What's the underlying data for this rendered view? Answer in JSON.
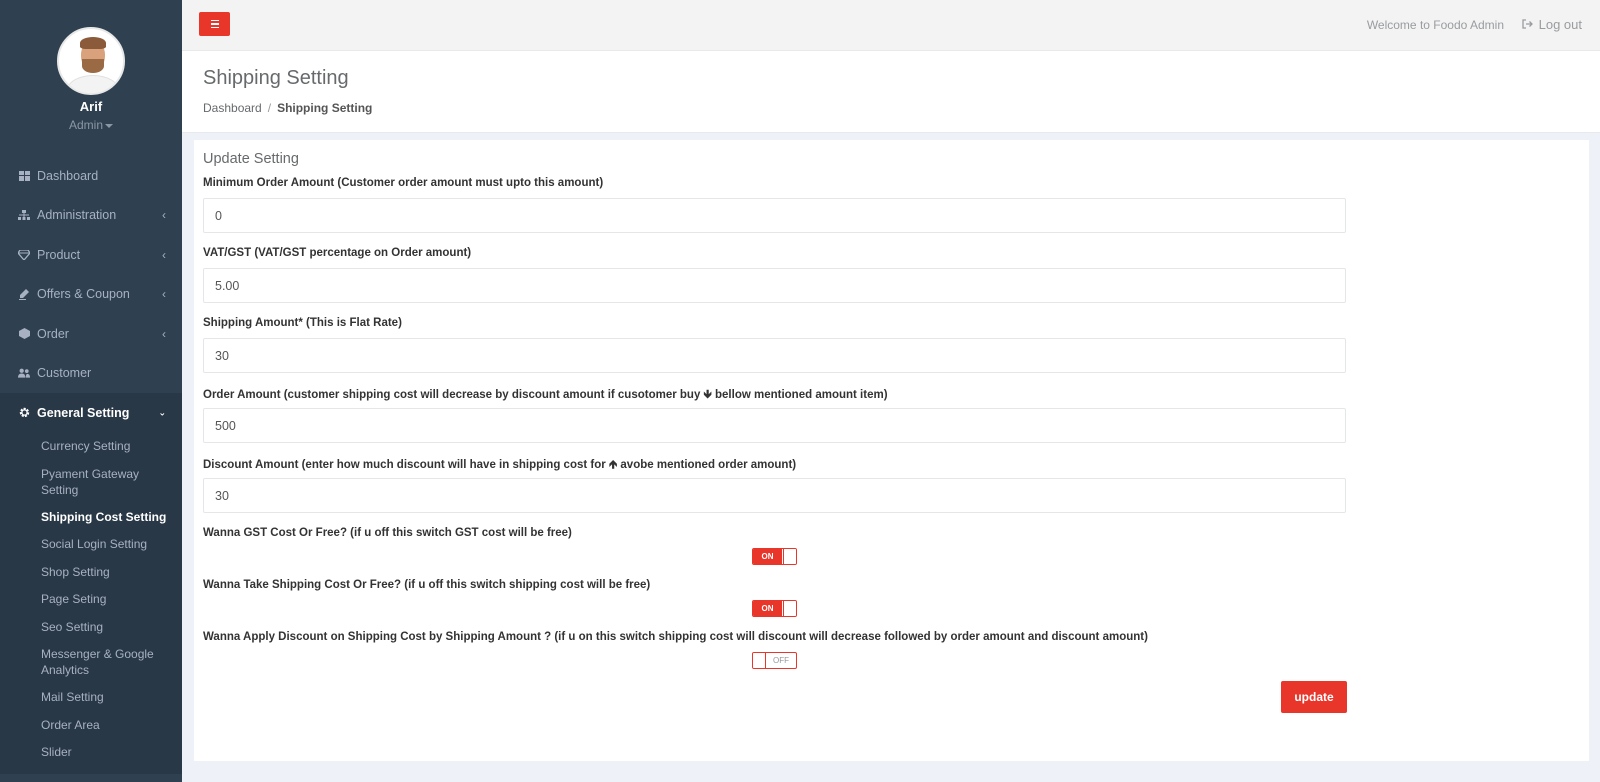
{
  "sidebar": {
    "profile": {
      "name": "Arif",
      "role": "Admin"
    },
    "items": [
      {
        "label": "Dashboard",
        "icon": "dashboard-icon"
      },
      {
        "label": "Administration",
        "icon": "sitemap-icon"
      },
      {
        "label": "Product",
        "icon": "diamond-icon"
      },
      {
        "label": "Offers & Coupon",
        "icon": "edit-icon"
      },
      {
        "label": "Order",
        "icon": "cube-icon"
      },
      {
        "label": "Customer",
        "icon": "users-icon"
      },
      {
        "label": "General Setting",
        "icon": "gear-icon"
      }
    ],
    "submenu": [
      "Currency Setting",
      "Pyament Gateway Setting",
      "Shipping Cost Setting",
      "Social Login Setting",
      "Shop Setting",
      "Page Seting",
      "Seo Setting",
      "Messenger & Google Analytics",
      "Mail Setting",
      "Order Area",
      "Slider"
    ]
  },
  "topbar": {
    "welcome": "Welcome to Foodo Admin",
    "logout": "Log out"
  },
  "heading": {
    "title": "Shipping Setting",
    "breadcrumb": {
      "home": "Dashboard",
      "separator": "/",
      "current": "Shipping Setting"
    }
  },
  "form": {
    "title": "Update Setting",
    "fields": [
      {
        "label": "Minimum Order Amount (Customer order amount must upto this amount)",
        "value": "0"
      },
      {
        "label": "VAT/GST (VAT/GST percentage on Order amount)",
        "value": "5.00"
      },
      {
        "label": "Shipping Amount* (This is Flat Rate)",
        "value": "30"
      },
      {
        "label_before": "Order Amount (customer shipping cost will decrease by discount amount if cusotomer buy",
        "arrow": "🡻",
        "label_after": "bellow mentioned amount item)",
        "value": "500"
      },
      {
        "label_before": "Discount Amount (enter how much discount will have in shipping cost for",
        "arrow": "🡹",
        "label_after": "avobe mentioned order amount)",
        "value": "30"
      }
    ],
    "switches": [
      {
        "label": "Wanna GST Cost Or Free? (if u off this switch GST cost will be free)",
        "state": "ON"
      },
      {
        "label": "Wanna Take Shipping Cost Or Free? (if u off this switch shipping cost will be free)",
        "state": "ON"
      },
      {
        "label": "Wanna Apply Discount on Shipping Cost by Shipping Amount ? (if u on this switch shipping cost will discount will decrease followed by order amount and discount amount)",
        "state": "OFF"
      }
    ],
    "submit_label": "update"
  },
  "colors": {
    "sidebar": "#2f4050",
    "accent": "#e8362b"
  }
}
